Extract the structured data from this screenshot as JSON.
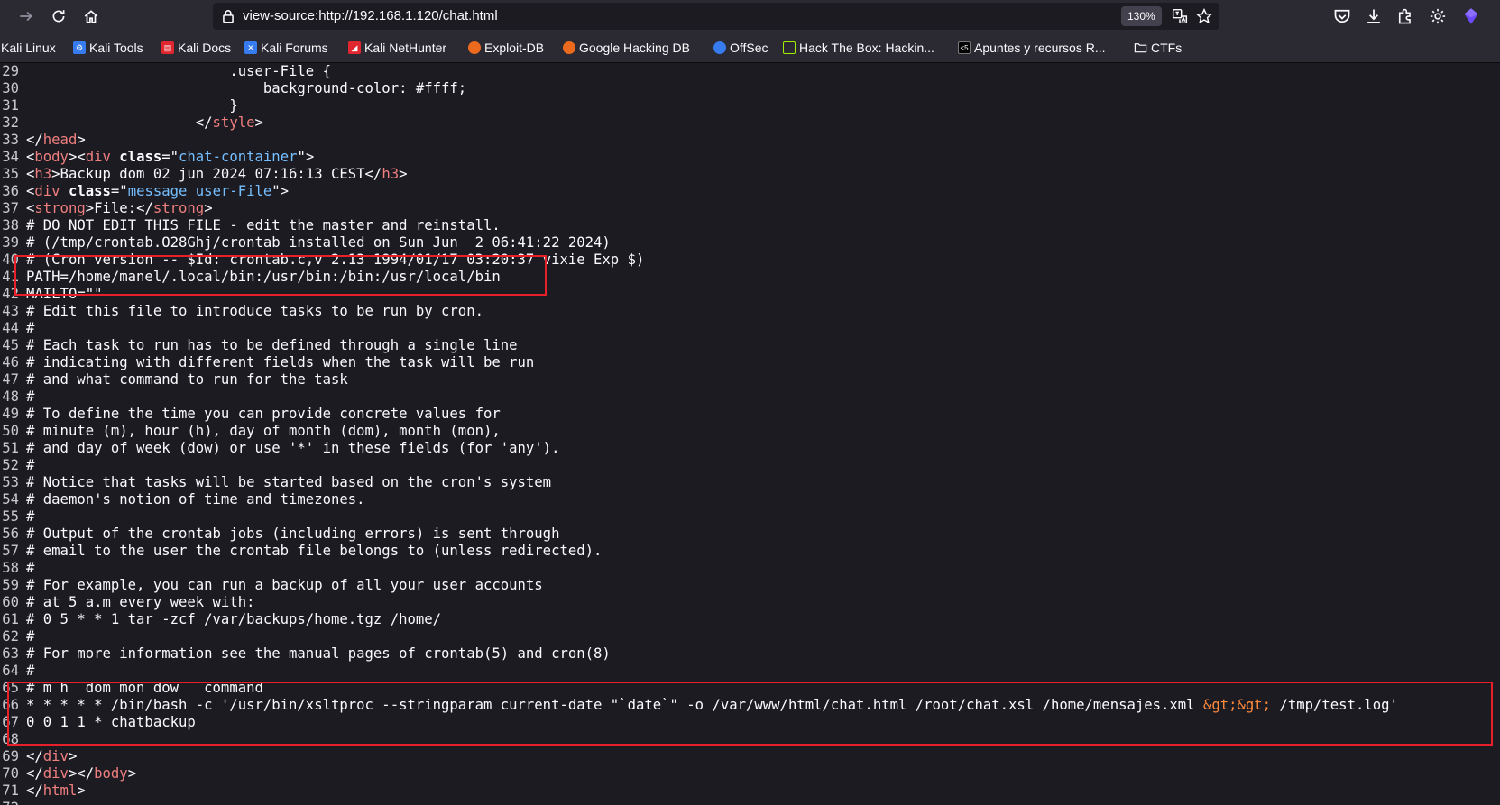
{
  "toolbar": {
    "back_icon": "arrow-left-icon",
    "forward_icon": "arrow-right-icon",
    "reload_icon": "reload-icon",
    "home_icon": "home-icon",
    "url": "view-source:http://192.168.1.120/chat.html",
    "zoom": "130%"
  },
  "bookmarks": [
    {
      "label": "Kali Linux",
      "icon": "",
      "color": ""
    },
    {
      "label": "Kali Tools",
      "icon": "kali-tools-icon",
      "color": "#367bf0"
    },
    {
      "label": "Kali Docs",
      "icon": "kali-docs-icon",
      "color": "#e0262e"
    },
    {
      "label": "Kali Forums",
      "icon": "kali-forums-icon",
      "color": "#367bf0"
    },
    {
      "label": "Kali NetHunter",
      "icon": "kali-nethunter-icon",
      "color": "#e0262e"
    },
    {
      "label": "Exploit-DB",
      "icon": "exploit-db-icon",
      "color": "#ec6a1e"
    },
    {
      "label": "Google Hacking DB",
      "icon": "ghdb-icon",
      "color": "#ec6a1e"
    },
    {
      "label": "OffSec",
      "icon": "offsec-icon",
      "color": "#367bf0"
    },
    {
      "label": "Hack The Box: Hackin...",
      "icon": "hackthebox-icon",
      "color": "#9fef00"
    },
    {
      "label": "Apuntes y recursos R...",
      "icon": "apuntes-icon",
      "color": "#000000"
    },
    {
      "label": "CTFs",
      "icon": "folder-icon",
      "color": ""
    }
  ],
  "source_lines": [
    {
      "n": "29",
      "segs": [
        {
          "t": "                        .user-File {",
          "c": ""
        }
      ]
    },
    {
      "n": "30",
      "segs": [
        {
          "t": "                            background-color: #ffff;",
          "c": ""
        }
      ]
    },
    {
      "n": "31",
      "segs": [
        {
          "t": "                        }",
          "c": ""
        }
      ]
    },
    {
      "n": "32",
      "segs": [
        {
          "t": "                    </",
          "c": ""
        },
        {
          "t": "style",
          "c": "tag"
        },
        {
          "t": ">",
          "c": ""
        }
      ]
    },
    {
      "n": "33",
      "segs": [
        {
          "t": "</",
          "c": ""
        },
        {
          "t": "head",
          "c": "tag"
        },
        {
          "t": ">",
          "c": ""
        }
      ]
    },
    {
      "n": "34",
      "segs": [
        {
          "t": "<",
          "c": ""
        },
        {
          "t": "body",
          "c": "tag"
        },
        {
          "t": "><",
          "c": ""
        },
        {
          "t": "div",
          "c": "tag"
        },
        {
          "t": " ",
          "c": ""
        },
        {
          "t": "class",
          "c": "attr-name"
        },
        {
          "t": "=\"",
          "c": ""
        },
        {
          "t": "chat-container",
          "c": "attr-val"
        },
        {
          "t": "\">",
          "c": ""
        }
      ]
    },
    {
      "n": "35",
      "segs": [
        {
          "t": "<",
          "c": ""
        },
        {
          "t": "h3",
          "c": "tag"
        },
        {
          "t": ">Backup dom 02 jun 2024 07:16:13 CEST</",
          "c": ""
        },
        {
          "t": "h3",
          "c": "tag"
        },
        {
          "t": ">",
          "c": ""
        }
      ]
    },
    {
      "n": "36",
      "segs": [
        {
          "t": "<",
          "c": ""
        },
        {
          "t": "div",
          "c": "tag"
        },
        {
          "t": " ",
          "c": ""
        },
        {
          "t": "class",
          "c": "attr-name"
        },
        {
          "t": "=\"",
          "c": ""
        },
        {
          "t": "message user-File",
          "c": "attr-val"
        },
        {
          "t": "\">",
          "c": ""
        }
      ]
    },
    {
      "n": "37",
      "segs": [
        {
          "t": "<",
          "c": ""
        },
        {
          "t": "strong",
          "c": "tag"
        },
        {
          "t": ">File:</",
          "c": ""
        },
        {
          "t": "strong",
          "c": "tag"
        },
        {
          "t": ">",
          "c": ""
        }
      ]
    },
    {
      "n": "38",
      "segs": [
        {
          "t": "# DO NOT EDIT THIS FILE - edit the master and reinstall.",
          "c": ""
        }
      ]
    },
    {
      "n": "39",
      "segs": [
        {
          "t": "# (/tmp/crontab.O28Ghj/crontab installed on Sun Jun  2 06:41:22 2024)",
          "c": ""
        }
      ]
    },
    {
      "n": "40",
      "segs": [
        {
          "t": "# (Cron version -- $Id: crontab.c,v 2.13 1994/01/17 03:20:37 vixie Exp $)",
          "c": ""
        }
      ]
    },
    {
      "n": "41",
      "segs": [
        {
          "t": "PATH=/home/manel/.local/bin:/usr/bin:/bin:/usr/local/bin",
          "c": ""
        }
      ]
    },
    {
      "n": "42",
      "segs": [
        {
          "t": "MAILTO=\"\"",
          "c": ""
        }
      ]
    },
    {
      "n": "43",
      "segs": [
        {
          "t": "# Edit this file to introduce tasks to be run by cron.",
          "c": ""
        }
      ]
    },
    {
      "n": "44",
      "segs": [
        {
          "t": "#",
          "c": ""
        }
      ]
    },
    {
      "n": "45",
      "segs": [
        {
          "t": "# Each task to run has to be defined through a single line",
          "c": ""
        }
      ]
    },
    {
      "n": "46",
      "segs": [
        {
          "t": "# indicating with different fields when the task will be run",
          "c": ""
        }
      ]
    },
    {
      "n": "47",
      "segs": [
        {
          "t": "# and what command to run for the task",
          "c": ""
        }
      ]
    },
    {
      "n": "48",
      "segs": [
        {
          "t": "#",
          "c": ""
        }
      ]
    },
    {
      "n": "49",
      "segs": [
        {
          "t": "# To define the time you can provide concrete values for",
          "c": ""
        }
      ]
    },
    {
      "n": "50",
      "segs": [
        {
          "t": "# minute (m), hour (h), day of month (dom), month (mon),",
          "c": ""
        }
      ]
    },
    {
      "n": "51",
      "segs": [
        {
          "t": "# and day of week (dow) or use '*' in these fields (for 'any').",
          "c": ""
        }
      ]
    },
    {
      "n": "52",
      "segs": [
        {
          "t": "#",
          "c": ""
        }
      ]
    },
    {
      "n": "53",
      "segs": [
        {
          "t": "# Notice that tasks will be started based on the cron's system",
          "c": ""
        }
      ]
    },
    {
      "n": "54",
      "segs": [
        {
          "t": "# daemon's notion of time and timezones.",
          "c": ""
        }
      ]
    },
    {
      "n": "55",
      "segs": [
        {
          "t": "#",
          "c": ""
        }
      ]
    },
    {
      "n": "56",
      "segs": [
        {
          "t": "# Output of the crontab jobs (including errors) is sent through",
          "c": ""
        }
      ]
    },
    {
      "n": "57",
      "segs": [
        {
          "t": "# email to the user the crontab file belongs to (unless redirected).",
          "c": ""
        }
      ]
    },
    {
      "n": "58",
      "segs": [
        {
          "t": "#",
          "c": ""
        }
      ]
    },
    {
      "n": "59",
      "segs": [
        {
          "t": "# For example, you can run a backup of all your user accounts",
          "c": ""
        }
      ]
    },
    {
      "n": "60",
      "segs": [
        {
          "t": "# at 5 a.m every week with:",
          "c": ""
        }
      ]
    },
    {
      "n": "61",
      "segs": [
        {
          "t": "# 0 5 * * 1 tar -zcf /var/backups/home.tgz /home/",
          "c": ""
        }
      ]
    },
    {
      "n": "62",
      "segs": [
        {
          "t": "#",
          "c": ""
        }
      ]
    },
    {
      "n": "63",
      "segs": [
        {
          "t": "# For more information see the manual pages of crontab(5) and cron(8)",
          "c": ""
        }
      ]
    },
    {
      "n": "64",
      "segs": [
        {
          "t": "#",
          "c": ""
        }
      ]
    },
    {
      "n": "65",
      "segs": [
        {
          "t": "# m h  dom mon dow   command",
          "c": ""
        }
      ]
    },
    {
      "n": "66",
      "segs": [
        {
          "t": "* * * * * /bin/bash -c '/usr/bin/xsltproc --stringparam current-date \"`date`\" -o /var/www/html/chat.html /root/chat.xsl /home/mensajes.xml ",
          "c": ""
        },
        {
          "t": "&gt;&gt;",
          "c": "entity"
        },
        {
          "t": " /tmp/test.log'",
          "c": ""
        }
      ]
    },
    {
      "n": "67",
      "segs": [
        {
          "t": "0 0 1 1 * chatbackup",
          "c": ""
        }
      ]
    },
    {
      "n": "68",
      "segs": [
        {
          "t": "",
          "c": ""
        }
      ]
    },
    {
      "n": "69",
      "segs": [
        {
          "t": "</",
          "c": ""
        },
        {
          "t": "div",
          "c": "tag"
        },
        {
          "t": ">",
          "c": ""
        }
      ]
    },
    {
      "n": "70",
      "segs": [
        {
          "t": "</",
          "c": ""
        },
        {
          "t": "div",
          "c": "tag"
        },
        {
          "t": "></",
          "c": ""
        },
        {
          "t": "body",
          "c": "tag"
        },
        {
          "t": ">",
          "c": ""
        }
      ]
    },
    {
      "n": "71",
      "segs": [
        {
          "t": "</",
          "c": ""
        },
        {
          "t": "html",
          "c": "tag"
        },
        {
          "t": ">",
          "c": ""
        }
      ]
    },
    {
      "n": "72",
      "segs": [
        {
          "t": "",
          "c": ""
        }
      ]
    }
  ],
  "highlights": {
    "color": "#e8202a"
  }
}
